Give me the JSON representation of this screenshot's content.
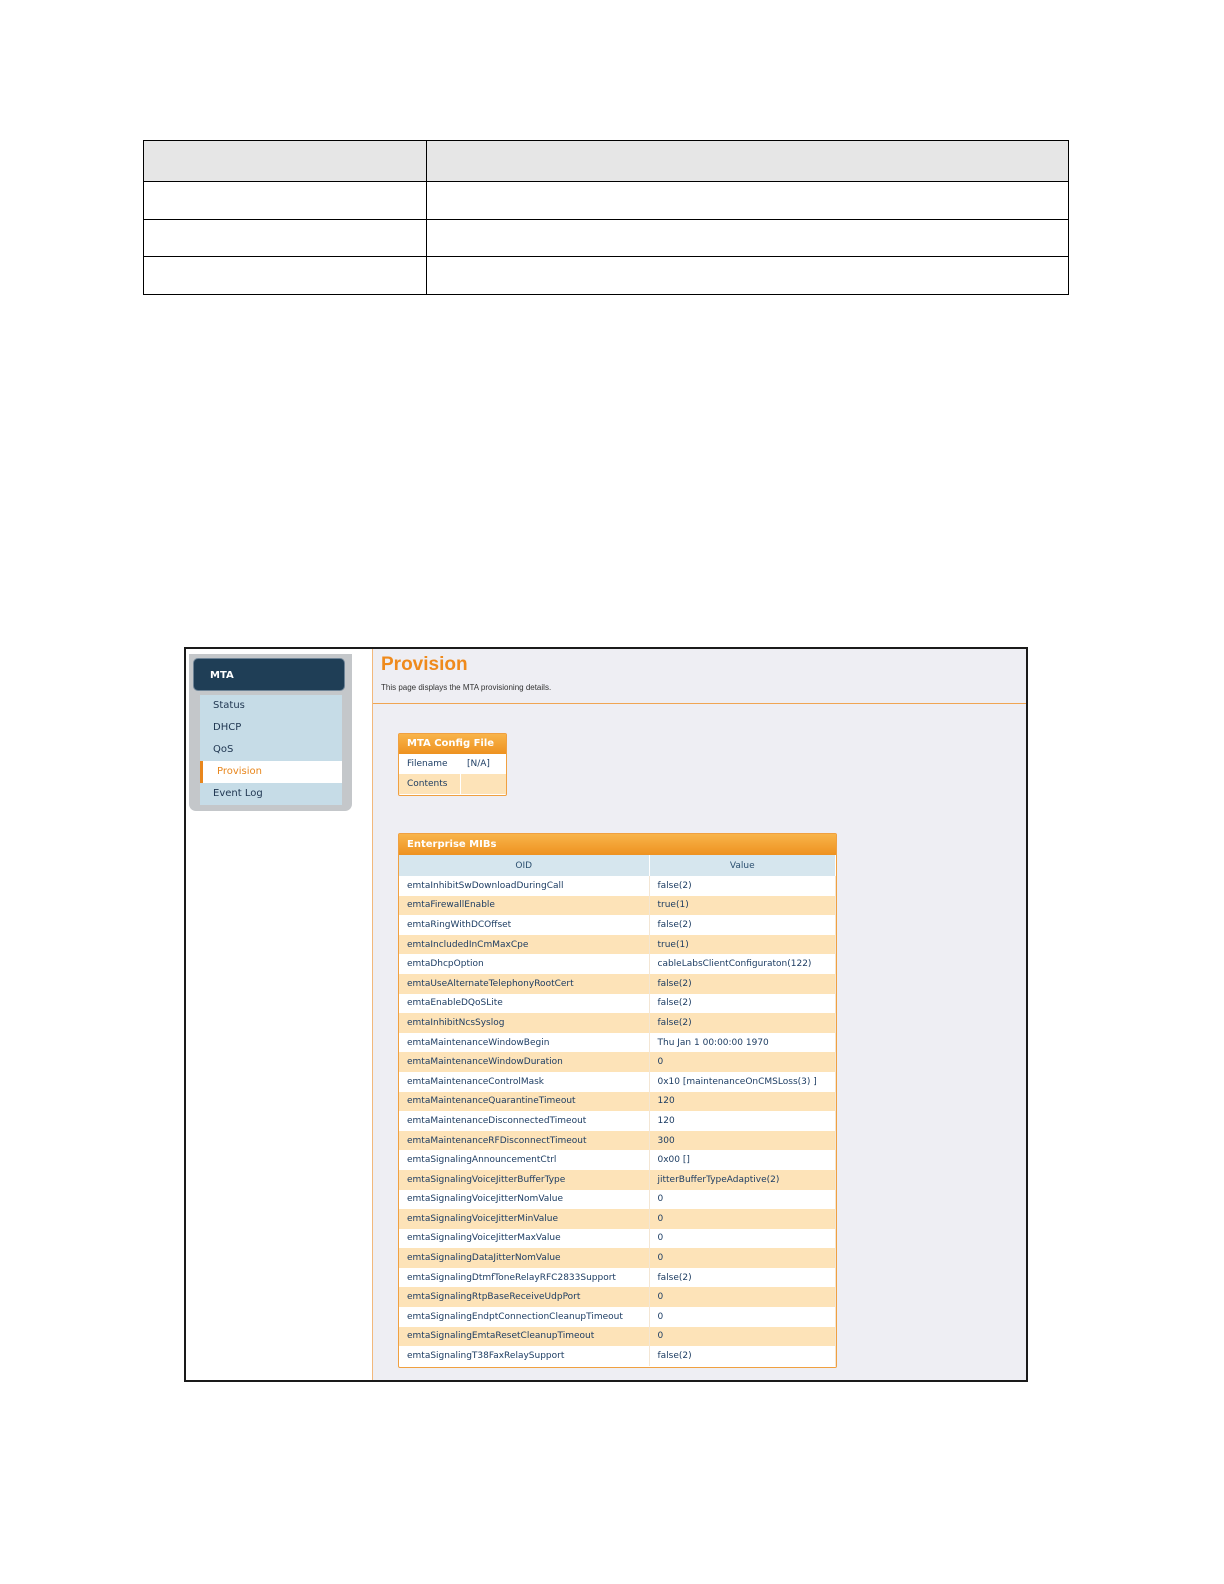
{
  "doc_table": {
    "rows": [
      [
        "",
        ""
      ],
      [
        "",
        ""
      ],
      [
        "",
        ""
      ],
      [
        "",
        ""
      ]
    ]
  },
  "sidebar": {
    "header": "MTA",
    "items": [
      {
        "label": "Status"
      },
      {
        "label": "DHCP"
      },
      {
        "label": "QoS"
      },
      {
        "label": "Provision",
        "active": true
      },
      {
        "label": "Event Log"
      }
    ]
  },
  "page": {
    "title": "Provision",
    "description": "This page displays the MTA provisioning details."
  },
  "config_file": {
    "title": "MTA Config File",
    "rows": [
      {
        "key": "Filename",
        "value": "[N/A]"
      },
      {
        "key": "Contents",
        "value": ""
      }
    ]
  },
  "mibs": {
    "title": "Enterprise MIBs",
    "columns": [
      "OID",
      "Value"
    ],
    "rows": [
      [
        "emtaInhibitSwDownloadDuringCall",
        "false(2)"
      ],
      [
        "emtaFirewallEnable",
        "true(1)"
      ],
      [
        "emtaRingWithDCOffset",
        "false(2)"
      ],
      [
        "emtaIncludedInCmMaxCpe",
        "true(1)"
      ],
      [
        "emtaDhcpOption",
        "cableLabsClientConfiguraton(122)"
      ],
      [
        "emtaUseAlternateTelephonyRootCert",
        "false(2)"
      ],
      [
        "emtaEnableDQoSLite",
        "false(2)"
      ],
      [
        "emtaInhibitNcsSyslog",
        "false(2)"
      ],
      [
        "emtaMaintenanceWindowBegin",
        "Thu Jan 1 00:00:00 1970"
      ],
      [
        "emtaMaintenanceWindowDuration",
        "0"
      ],
      [
        "emtaMaintenanceControlMask",
        "0x10 [maintenanceOnCMSLoss(3) ]"
      ],
      [
        "emtaMaintenanceQuarantineTimeout",
        "120"
      ],
      [
        "emtaMaintenanceDisconnectedTimeout",
        "120"
      ],
      [
        "emtaMaintenanceRFDisconnectTimeout",
        "300"
      ],
      [
        "emtaSignalingAnnouncementCtrl",
        "0x00 []"
      ],
      [
        "emtaSignalingVoiceJitterBufferType",
        "jitterBufferTypeAdaptive(2)"
      ],
      [
        "emtaSignalingVoiceJitterNomValue",
        "0"
      ],
      [
        "emtaSignalingVoiceJitterMinValue",
        "0"
      ],
      [
        "emtaSignalingVoiceJitterMaxValue",
        "0"
      ],
      [
        "emtaSignalingDataJitterNomValue",
        "0"
      ],
      [
        "emtaSignalingDtmfToneRelayRFC2833Support",
        "false(2)"
      ],
      [
        "emtaSignalingRtpBaseReceiveUdpPort",
        "0"
      ],
      [
        "emtaSignalingEndptConnectionCleanupTimeout",
        "0"
      ],
      [
        "emtaSignalingEmtaResetCleanupTimeout",
        "0"
      ],
      [
        "emtaSignalingT38FaxRelaySupport",
        "false(2)"
      ]
    ]
  }
}
